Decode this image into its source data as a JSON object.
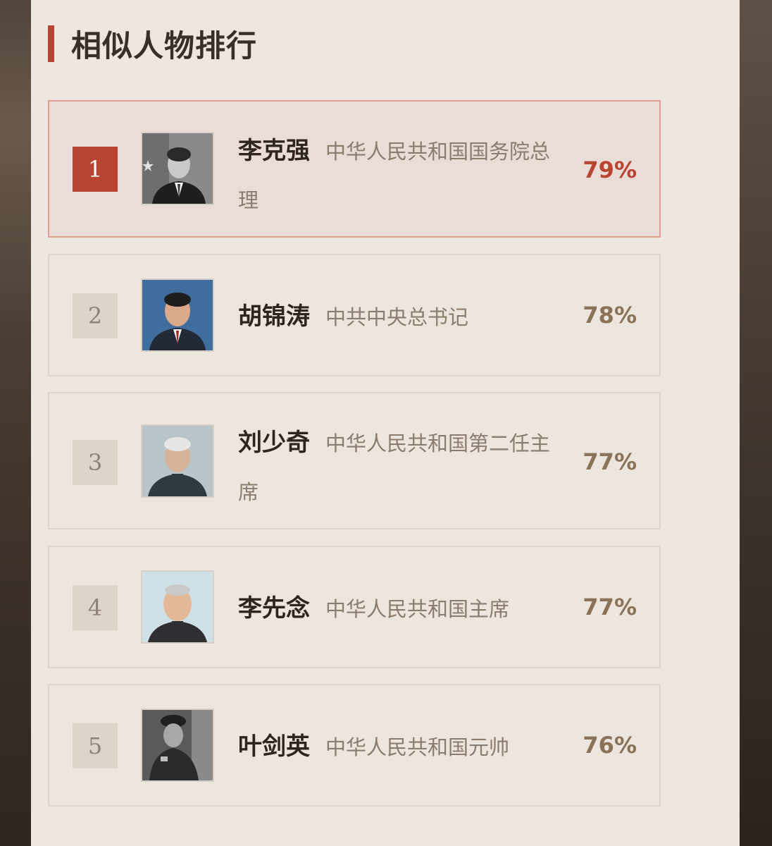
{
  "section": {
    "title": "相似人物排行"
  },
  "colors": {
    "accent": "#b84431",
    "card_border_active": "#dd9f93",
    "percent_normal": "#8a7358"
  },
  "ranking": [
    {
      "rank": "1",
      "name": "李克强",
      "desc": "中华人民共和国国务院总理",
      "percent": "79%",
      "active": true,
      "avatar_icon": "portrait-photo-icon"
    },
    {
      "rank": "2",
      "name": "胡锦涛",
      "desc": "中共中央总书记",
      "percent": "78%",
      "active": false,
      "avatar_icon": "portrait-photo-icon"
    },
    {
      "rank": "3",
      "name": "刘少奇",
      "desc": "中华人民共和国第二任主席",
      "percent": "77%",
      "active": false,
      "avatar_icon": "portrait-photo-icon"
    },
    {
      "rank": "4",
      "name": "李先念",
      "desc": "中华人民共和国主席",
      "percent": "77%",
      "active": false,
      "avatar_icon": "portrait-photo-icon"
    },
    {
      "rank": "5",
      "name": "叶剑英",
      "desc": "中华人民共和国元帅",
      "percent": "76%",
      "active": false,
      "avatar_icon": "portrait-photo-icon"
    }
  ]
}
